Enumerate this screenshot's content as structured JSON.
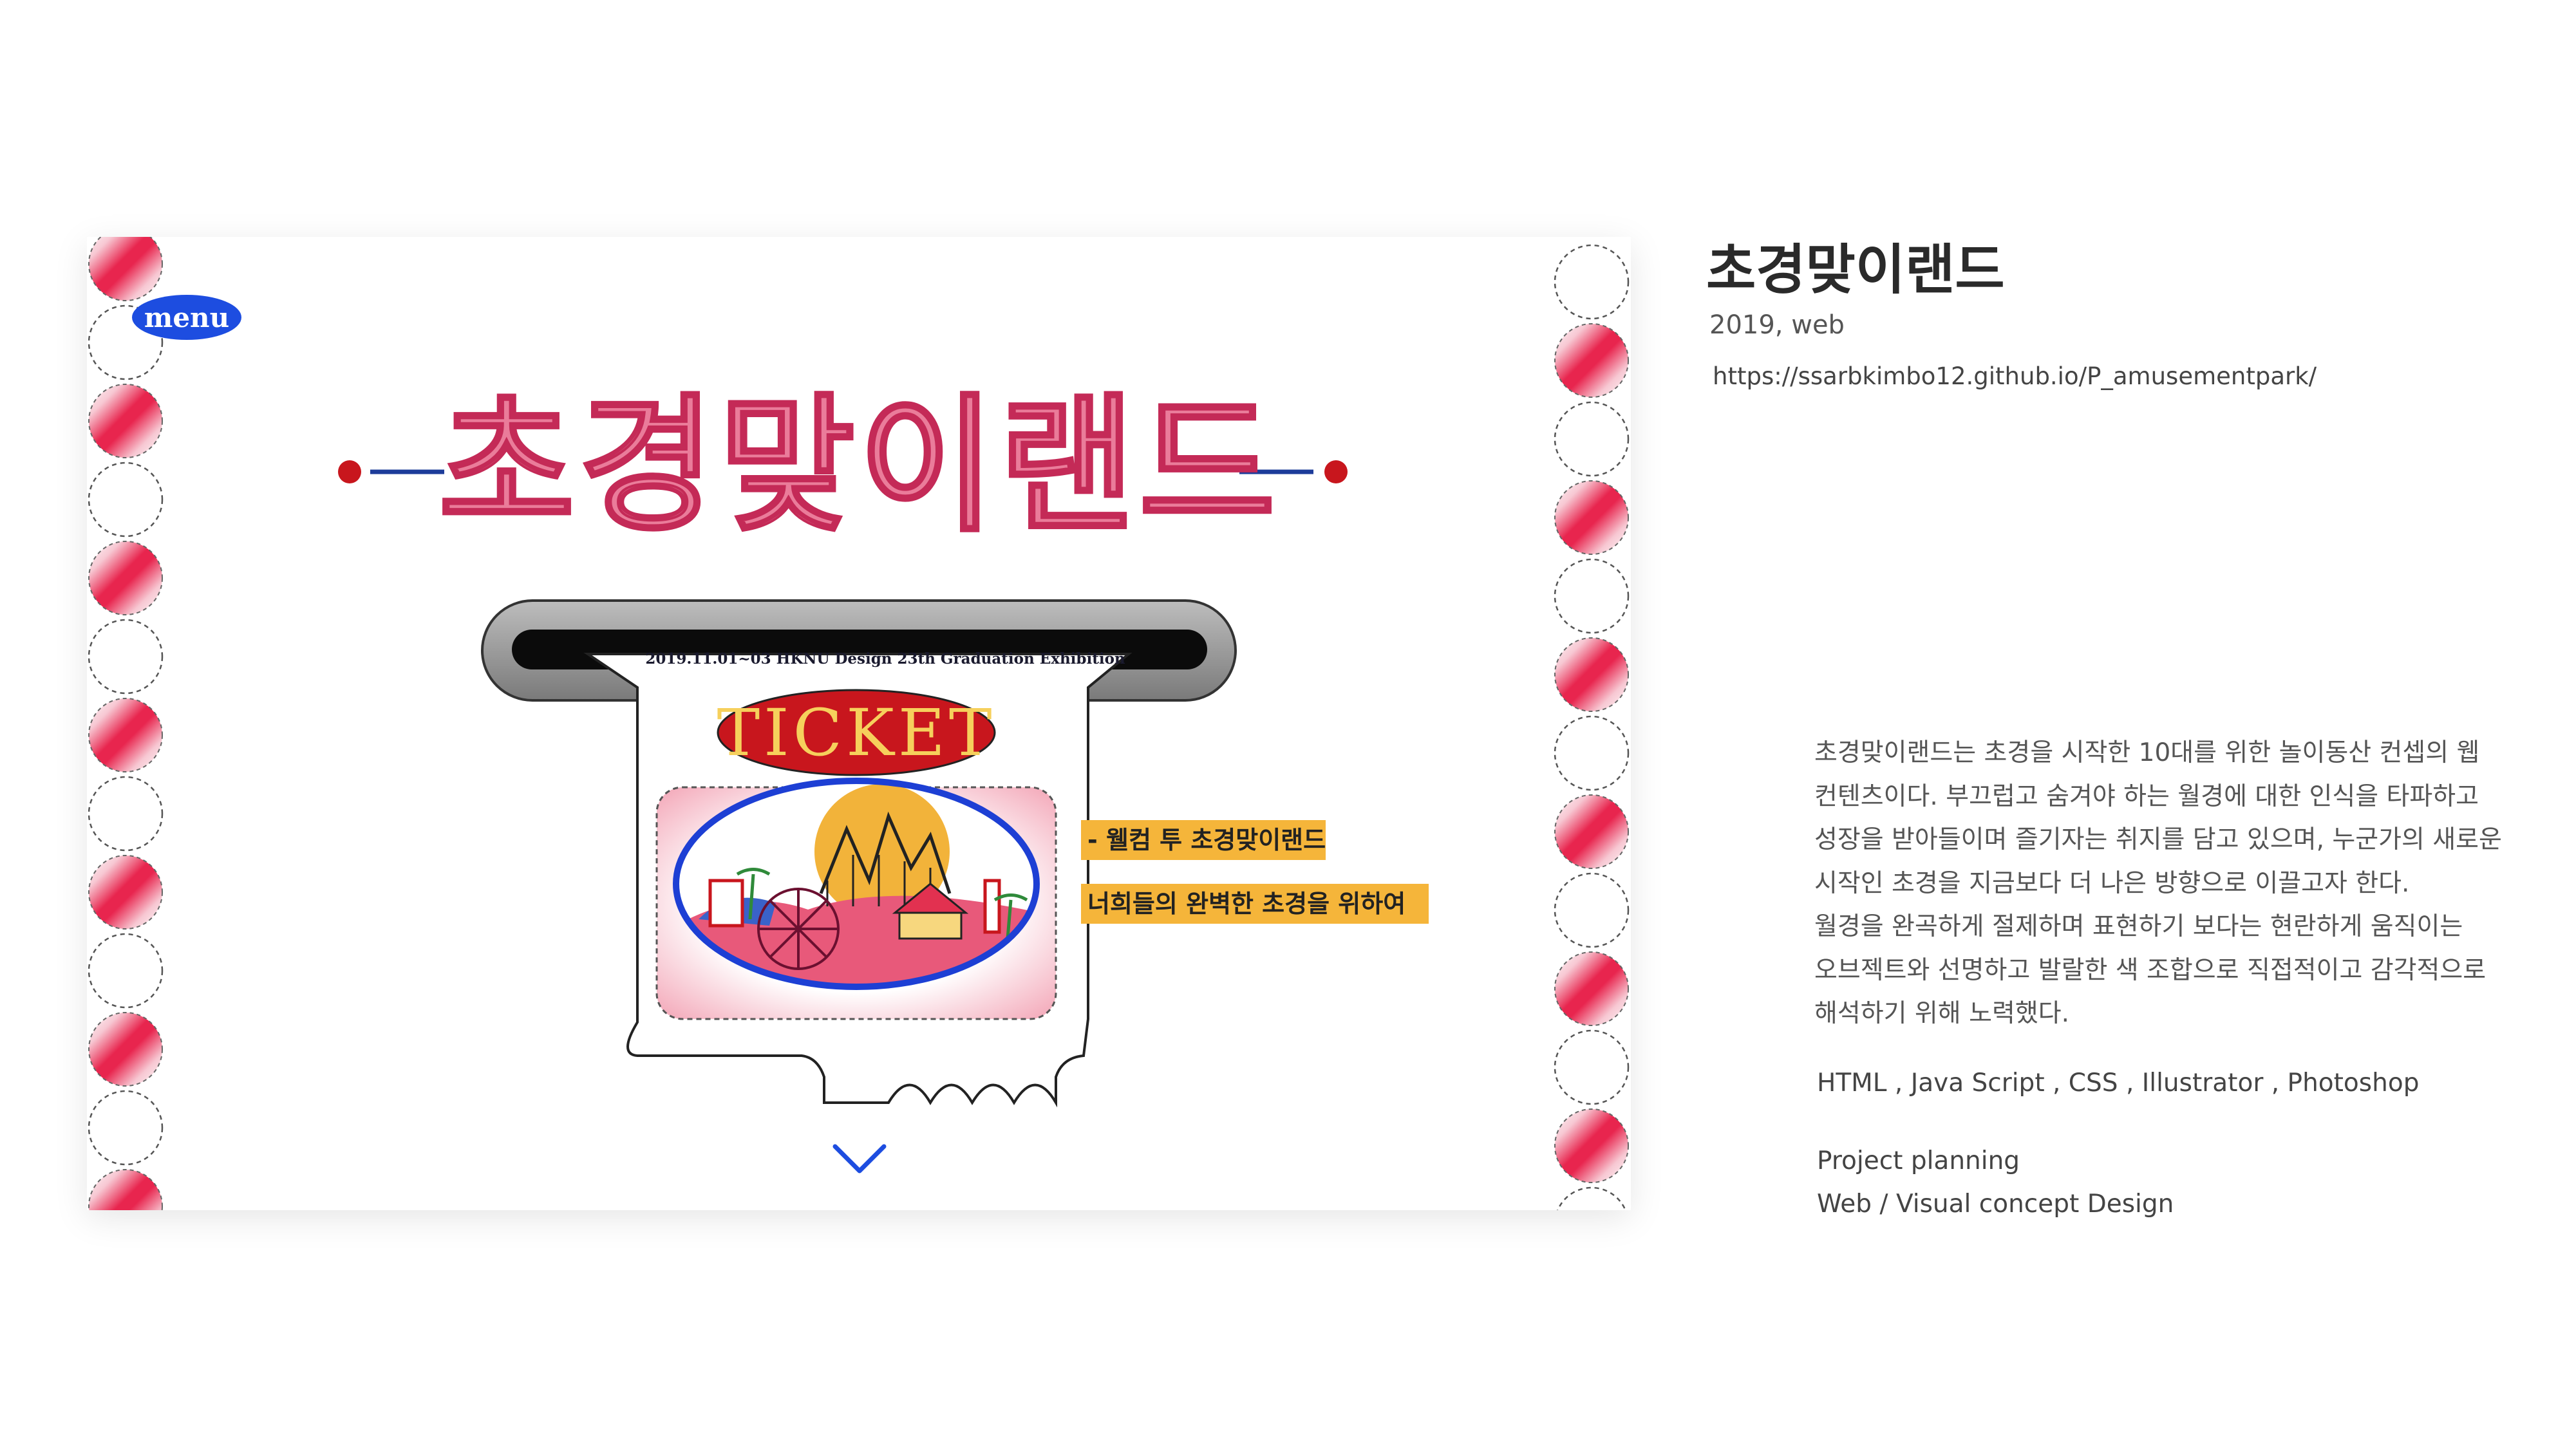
{
  "preview": {
    "menu_label": "menu",
    "title": "초경맞이랜드",
    "event_line": "2019.11.01~03 HKNU Design 23th Graduation Exhibition",
    "ticket_label": "TICKET",
    "banners": [
      "- 웰컴 투 초경맞이랜드",
      "너희들의 완벽한 초경을 위하여"
    ],
    "colors": {
      "accent_blue": "#1d4de0",
      "title_pink": "#ea7c9a",
      "ticket_red": "#c8161d",
      "banner_orange": "#f5b53a"
    }
  },
  "project": {
    "title": "초경맞이랜드",
    "meta": "2019, web",
    "url": "https://ssarbkimbo12.github.io/P_amusementpark/",
    "description": [
      "초경맞이랜드는 초경을 시작한 10대를 위한 놀이동산 컨셉의 웹",
      "컨텐츠이다. 부끄럽고 숨겨야 하는 월경에 대한 인식을 타파하고",
      "성장을 받아들이며 즐기자는 취지를 담고 있으며, 누군가의 새로운",
      "시작인 초경을 지금보다 더 나은 방향으로 이끌고자 한다.",
      "월경을 완곡하게 절제하며 표현하기 보다는 현란하게 움직이는",
      "오브젝트와 선명하고 발랄한 색 조합으로 직접적이고 감각적으로",
      "해석하기 위해 노력했다."
    ],
    "tools": "HTML , Java Script , CSS , Illustrator , Photoshop",
    "roles": [
      "Project planning",
      "Web / Visual concept Design"
    ]
  }
}
